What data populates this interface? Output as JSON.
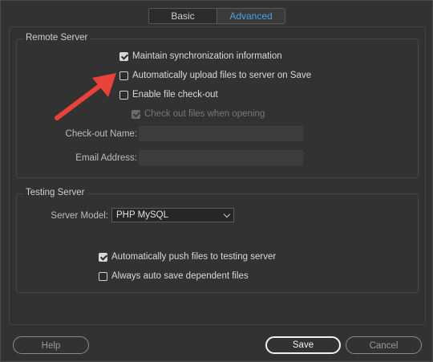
{
  "tabs": [
    {
      "label": "Basic"
    },
    {
      "label": "Advanced"
    }
  ],
  "remote_server": {
    "title": "Remote Server",
    "maintain_sync": {
      "label": "Maintain synchronization information",
      "checked": true
    },
    "auto_upload": {
      "label": "Automatically upload files to server on Save",
      "checked": false
    },
    "enable_checkout": {
      "label": "Enable file check-out",
      "checked": false
    },
    "checkout_on_open": {
      "label": "Check out files when opening",
      "checked": true,
      "disabled": true
    },
    "checkout_name_label": "Check-out Name:",
    "checkout_name_value": "",
    "email_label": "Email Address:",
    "email_value": ""
  },
  "testing_server": {
    "title": "Testing Server",
    "model_label": "Server Model:",
    "model_value": "PHP MySQL",
    "auto_push": {
      "label": "Automatically push files to testing server",
      "checked": true
    },
    "auto_save_dependent": {
      "label": "Always auto save dependent files",
      "checked": false
    }
  },
  "buttons": {
    "help": "Help",
    "save": "Save",
    "cancel": "Cancel"
  },
  "annotation": {
    "arrow_color": "#e8423a"
  }
}
